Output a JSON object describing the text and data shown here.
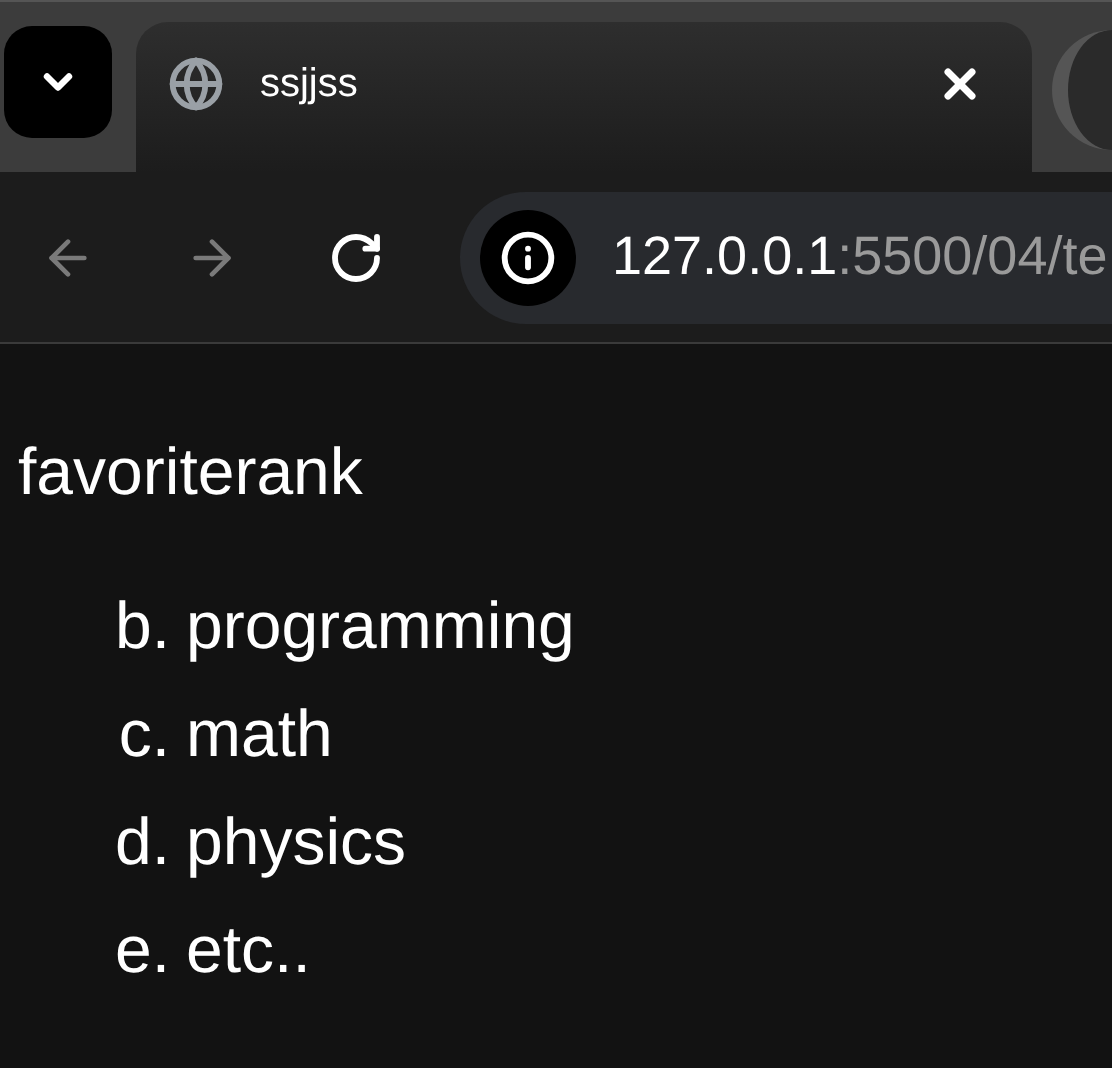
{
  "tab": {
    "title": "ssjjss"
  },
  "toolbar": {
    "back": {
      "disabled": true
    },
    "forward": {
      "disabled": true
    },
    "address": {
      "host": "127.0.0.1",
      "rest": ":5500/04/te"
    }
  },
  "page": {
    "heading": "favoriterank",
    "list": [
      {
        "marker": "b.",
        "text": "programming"
      },
      {
        "marker": "c.",
        "text": "math"
      },
      {
        "marker": "d.",
        "text": "physics"
      },
      {
        "marker": "e.",
        "text": "etc.."
      }
    ]
  }
}
